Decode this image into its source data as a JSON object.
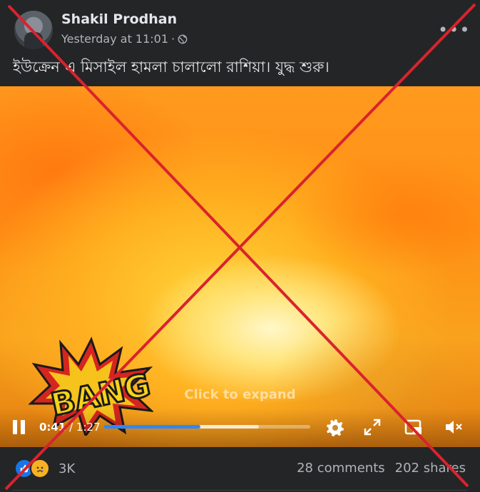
{
  "post": {
    "author": "Shakil Prodhan",
    "timestamp": "Yesterday at 11:01",
    "separator": "·",
    "audience_icon": "globe-icon",
    "more_label": "•••",
    "text": "ইউক্রেন এ মিসাইল হামলা চালালো রাশিয়া। যুদ্ধ শুরু।"
  },
  "video": {
    "overlay_text": "Click to expand",
    "current_time": "0:41",
    "time_separator": " / ",
    "duration": "1:27",
    "played_fraction": 0.47,
    "buffered_fraction": 0.75,
    "sticker_text": "BANG",
    "icons": [
      "pause-icon",
      "gear-icon",
      "fullscreen-icon",
      "pip-icon",
      "mute-icon"
    ]
  },
  "footer": {
    "reaction_icons": [
      "like-icon",
      "sad-icon"
    ],
    "reaction_count": "3K",
    "comments": "28 comments",
    "shares": "202 shares"
  },
  "colors": {
    "background": "#242526",
    "text_primary": "#e4e6eb",
    "text_secondary": "#b0b3b8",
    "progress_played": "#2d88ff",
    "cross_mark": "#d9232e"
  }
}
